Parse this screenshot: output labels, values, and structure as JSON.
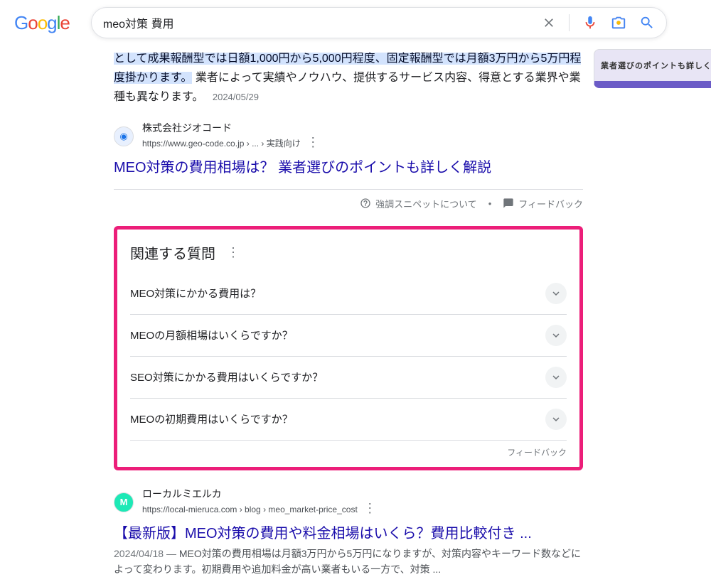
{
  "search": {
    "query": "meo対策 費用"
  },
  "snippet": {
    "highlighted": "として成果報酬型では日額1,000円から5,000円程度、固定報酬型では月額3万円から5万円程度掛かります。",
    "rest": " 業者によって実績やノウハウ、提供するサービス内容、得意とする業界や業種も異なります。",
    "date": "2024/05/29",
    "thumb_text": "業者選びのポイントも詳しく解説",
    "source_name": "株式会社ジオコード",
    "source_url": "https://www.geo-code.co.jp › ... › 実践向け",
    "title": "MEO対策の費用相場は？ 業者選びのポイントも詳しく解説"
  },
  "footer": {
    "about_snippet": "強調スニペットについて",
    "feedback": "フィードバック"
  },
  "paa": {
    "title": "関連する質問",
    "items": [
      "MEO対策にかかる費用は？",
      "MEOの月額相場はいくらですか？",
      "SEO対策にかかる費用はいくらですか？",
      "MEOの初期費用はいくらですか？"
    ],
    "feedback": "フィードバック"
  },
  "result2": {
    "source_name": "ローカルミエルカ",
    "source_url": "https://local-mieruca.com › blog › meo_market-price_cost",
    "title": "【最新版】MEO対策の費用や料金相場はいくら？費用比較付き ...",
    "date": "2024/04/18 — ",
    "desc": "MEO対策の費用相場は月額3万円から5万円になりますが、対策内容やキーワード数などによって変わります。初期費用や追加料金が高い業者もいる一方で、対策 ..."
  }
}
